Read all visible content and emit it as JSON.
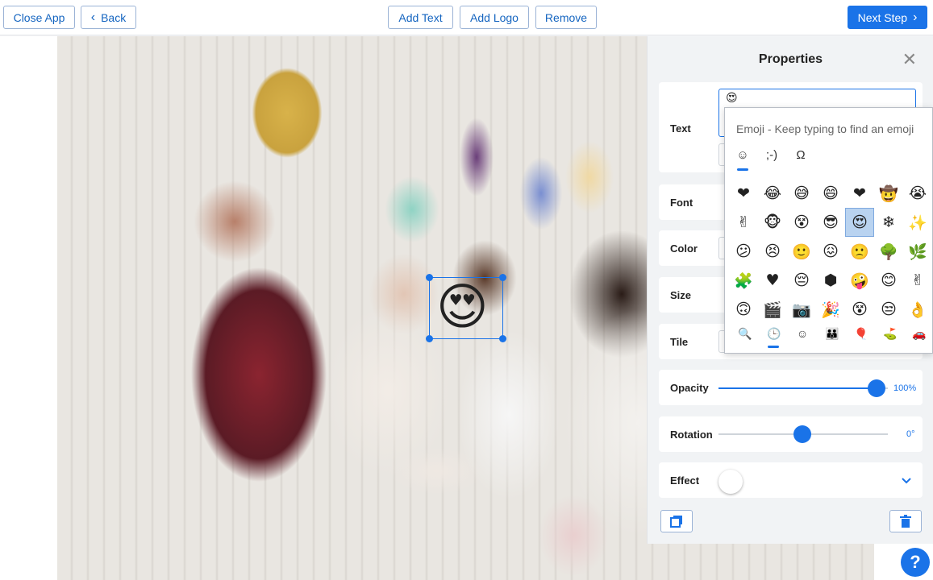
{
  "toolbar": {
    "close_app": "Close App",
    "back": "Back",
    "add_text": "Add Text",
    "add_logo": "Add Logo",
    "remove": "Remove",
    "next_step": "Next Step"
  },
  "canvas": {
    "selected_sticker": "😍"
  },
  "properties": {
    "title": "Properties",
    "text_label": "Text",
    "text_value": "😍",
    "font_label": "Font",
    "color_label": "Color",
    "size_label": "Size",
    "tile_label": "Tile",
    "opacity_label": "Opacity",
    "opacity_value": "100%",
    "opacity_level": 1.0,
    "rotation_label": "Rotation",
    "rotation_value": "0°",
    "effect_label": "Effect"
  },
  "emoji_picker": {
    "hint": "Emoji - Keep typing to find an emoji",
    "category_tabs": [
      "☺",
      ";-)",
      "Ω"
    ],
    "recent": [
      "❤",
      "😂",
      "😅",
      "😄",
      "❤",
      "🤠",
      "😭",
      "✌",
      "🐵",
      "😵",
      "😎",
      "😍",
      "❄",
      "✨",
      "😕",
      "😣",
      "🙂",
      "😖",
      "🙁",
      "🌳",
      "🌿",
      "🧩",
      "♥",
      "😔",
      "⬢",
      "🤪",
      "😊",
      "✌",
      "🙃",
      "🎬",
      "📷",
      "🎉",
      "😵",
      "😒",
      "👌"
    ],
    "selected_index": 11,
    "bottom_tabs": [
      "🔍",
      "🕒",
      "☺",
      "👪",
      "🎈",
      "⛳",
      "🚗"
    ]
  },
  "help": "?",
  "colors": {
    "accent": "#1a73e8",
    "selection": "#b9d3f0"
  }
}
